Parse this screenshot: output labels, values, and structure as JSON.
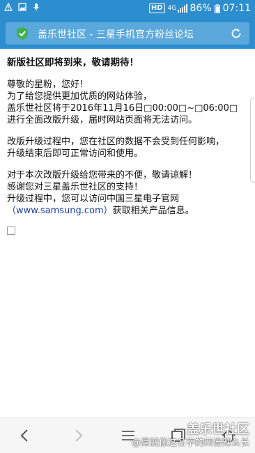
{
  "status_bar": {
    "network_badge": "HD",
    "network_type": "4G",
    "battery": "86%",
    "time": "07:11"
  },
  "address_bar": {
    "title": "盖乐世社区 - 三星手机官方粉丝论坛"
  },
  "content": {
    "headline": "新版社区即将到来，敬请期待！",
    "para1": [
      "尊敬的星粉，您好！",
      "为了给您提供更加优质的网站体验，",
      "盖乐世社区将于2016年11月16日□00:00□~□06:00□",
      "进行全面改版升级，届时网站页面将无法访问。"
    ],
    "para2": [
      "改版升级过程中，您在社区的数据不会受到任何影响，",
      "升级结束后即可正常访问和使用。"
    ],
    "para3": [
      "对于本次改版升级给您带来的不便，敬请谅解！",
      "感谢您对三星盖乐世社区的支持！",
      "升级过程中，您可以访问中国三星电子官网"
    ],
    "link_open": "（",
    "link_text": "www.samsung.com",
    "link_close": "）",
    "link_suffix": "获取相关产品信息。"
  },
  "watermark": {
    "logo": "盖乐世社区",
    "user": "@屌就像这名字的四倍辣么长"
  },
  "toolbar": {
    "icons": [
      "back-icon",
      "forward-icon",
      "menu-icon",
      "tabs-icon",
      "home-icon"
    ]
  },
  "colors": {
    "bar_blue": "#2d8ecf",
    "url_box": "#5aa8dc",
    "shield_green": "#3db34a",
    "link_blue": "#1a3fa8"
  }
}
